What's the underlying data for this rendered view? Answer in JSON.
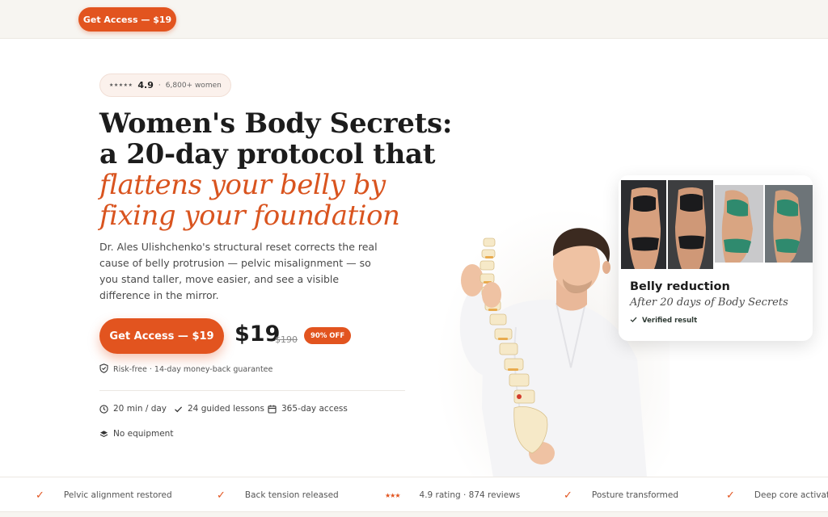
{
  "colors": {
    "accent": "#e2541f",
    "topbar": "#f7f5f1",
    "text": "#1c1c1c"
  },
  "topbar": {
    "cta_label": "Get Access — $19"
  },
  "rating": {
    "stars": "★★★★★",
    "score": "4.9",
    "separator": "·",
    "count": "6,800+ women"
  },
  "headline": {
    "line1": "Women's Body Secrets:",
    "line2": "a 20-day protocol that",
    "line3": "flattens your belly by",
    "line4": "fixing your foundation"
  },
  "description": "Dr. Ales Ulishchenko's structural reset corrects the real cause of belly protrusion — pelvic misalignment — so you stand taller, move easier, and see a visible difference in the mirror.",
  "offer": {
    "cta_label": "Get Access — $19",
    "price": "$19",
    "old_price": "$190",
    "discount": "90% OFF",
    "guarantee": "Risk-free · 14-day money-back guarantee"
  },
  "features": [
    {
      "icon": "clock-icon",
      "label": "20 min / day"
    },
    {
      "icon": "check-icon",
      "label": "24 guided lessons"
    },
    {
      "icon": "calendar-icon",
      "label": "365-day access"
    },
    {
      "icon": "layers-icon",
      "label": "No equipment"
    }
  ],
  "result_card": {
    "title": "Belly reduction",
    "subtitle": "After 20 days of Body Secrets",
    "verified": "Verified result"
  },
  "marquee": [
    {
      "icon": "check-icon",
      "label": "Pelvic alignment restored"
    },
    {
      "icon": "check-icon",
      "label": "Back tension released"
    },
    {
      "icon": "stars-icon",
      "stars": "★★★",
      "label": "4.9 rating · 874 reviews"
    },
    {
      "icon": "check-icon",
      "label": "Posture transformed"
    },
    {
      "icon": "check-icon",
      "label": "Deep core activate"
    }
  ],
  "marquee_check": "✓"
}
